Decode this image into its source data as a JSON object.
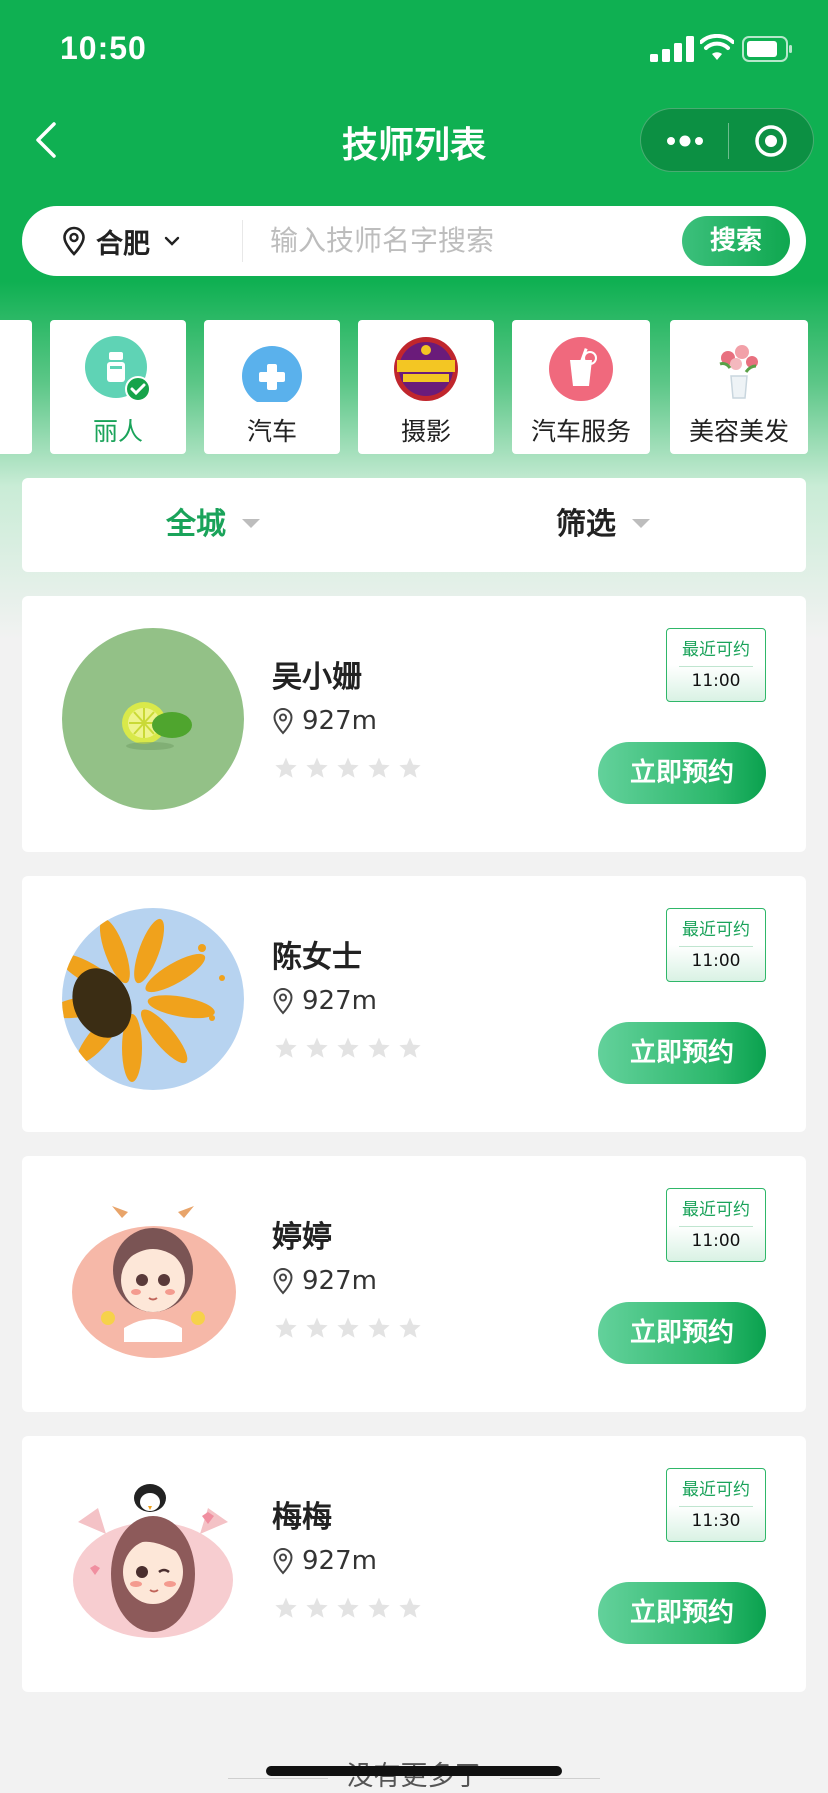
{
  "status_bar": {
    "time": "10:50"
  },
  "nav": {
    "title": "技师列表"
  },
  "search": {
    "city": "合肥",
    "placeholder": "输入技师名字搜索",
    "button": "搜索"
  },
  "categories": [
    {
      "label": "丽人",
      "icon": "beauty-icon",
      "selected": true
    },
    {
      "label": "汽车",
      "icon": "car-kit-icon"
    },
    {
      "label": "摄影",
      "icon": "photography-badge-icon"
    },
    {
      "label": "汽车服务",
      "icon": "drink-icon"
    },
    {
      "label": "美容美发",
      "icon": "flower-vase-icon"
    }
  ],
  "filters": {
    "area": "全城",
    "filter": "筛选"
  },
  "technicians": [
    {
      "name": "吴小姗",
      "distance": "927m",
      "recent_label": "最近可约",
      "time": "11:00",
      "book": "立即预约",
      "rating": 0
    },
    {
      "name": "陈女士",
      "distance": "927m",
      "recent_label": "最近可约",
      "time": "11:00",
      "book": "立即预约",
      "rating": 0
    },
    {
      "name": "婷婷",
      "distance": "927m",
      "recent_label": "最近可约",
      "time": "11:00",
      "book": "立即预约",
      "rating": 0
    },
    {
      "name": "梅梅",
      "distance": "927m",
      "recent_label": "最近可约",
      "time": "11:30",
      "book": "立即预约",
      "rating": 0
    }
  ],
  "footer": {
    "no_more": "没有更多了"
  },
  "colors": {
    "brand": "#0fb052",
    "accent": "#1aa35a"
  }
}
